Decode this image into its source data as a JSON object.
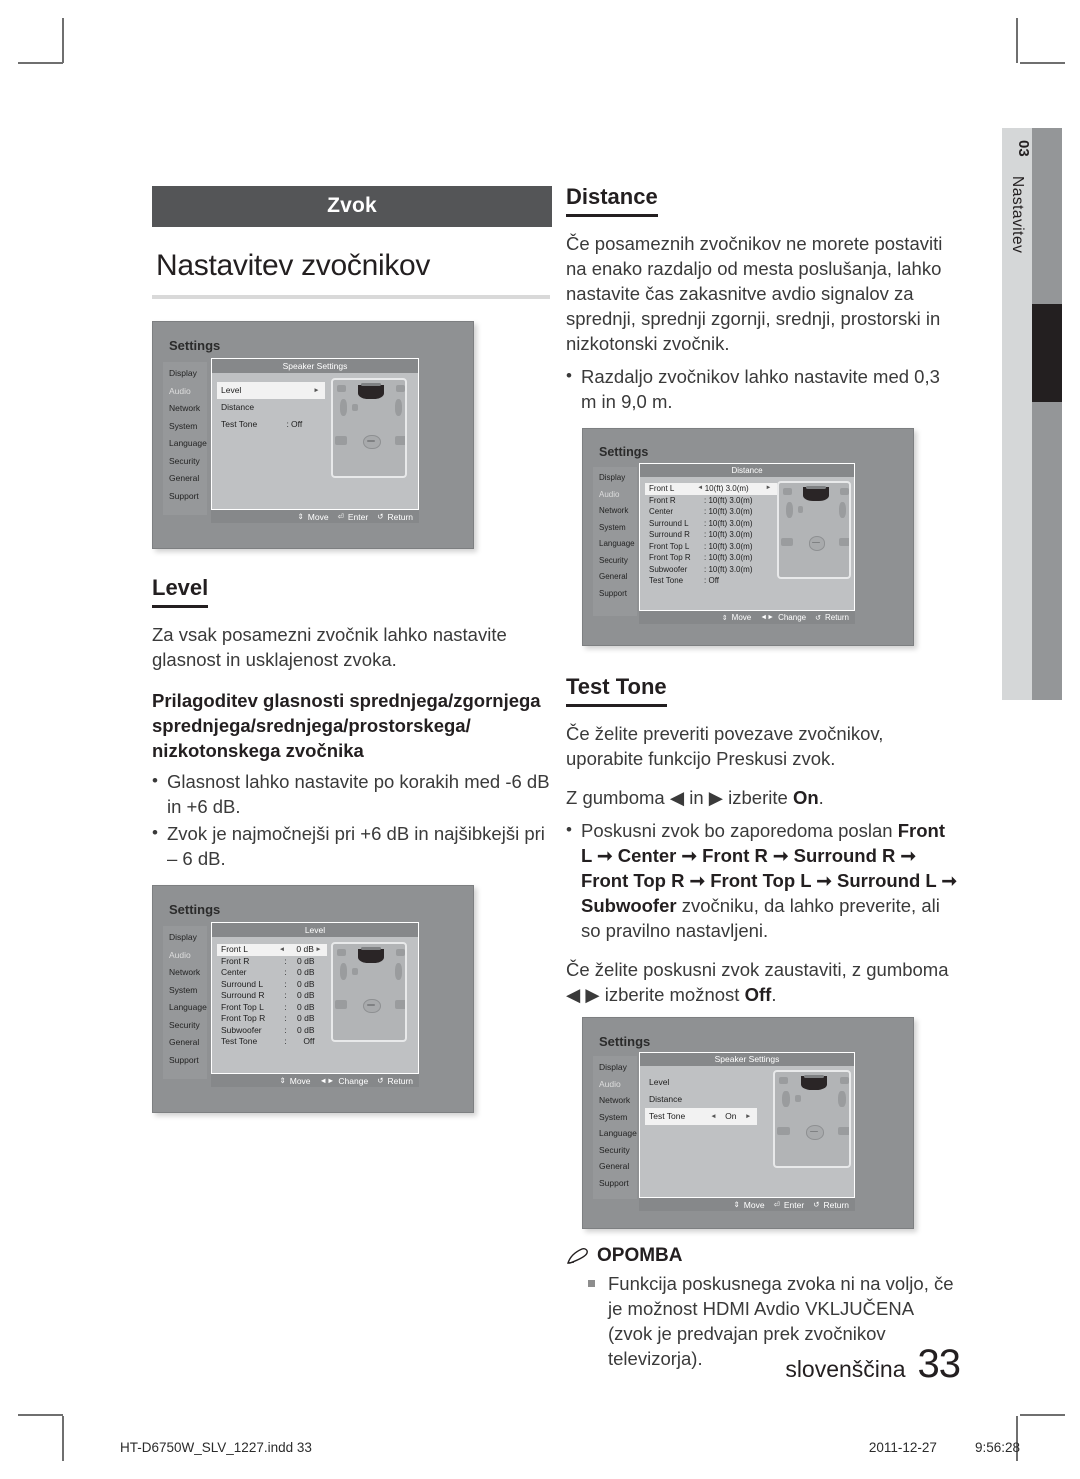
{
  "page": {
    "section_bar_label": "Zvok",
    "title": "Nastavitev zvočnikov",
    "language": "slovenščina",
    "page_number": "33",
    "side_tab": {
      "number": "03",
      "label": "Nastavitev"
    }
  },
  "footer": {
    "file": "HT-D6750W_SLV_1227.indd   33",
    "date": "2011-12-27",
    "time": "9:56:28"
  },
  "left": {
    "level": {
      "heading": "Level",
      "para": "Za vsak posamezni zvočnik lahko nastavite glasnost in usklajenost zvoka.",
      "bold_heading": "Prilagoditev glasnosti sprednjega/zgornjega sprednjega/srednjega/prostorskega/ nizkotonskega zvočnika",
      "bullets": [
        "Glasnost lahko nastavite po korakih med -6 dB in +6 dB.",
        "Zvok je najmočnejši pri +6 dB in najšibkejši pri – 6 dB."
      ]
    }
  },
  "right": {
    "distance": {
      "heading": "Distance",
      "para": "Če posameznih zvočnikov ne morete postaviti na enako razdaljo od mesta poslušanja, lahko nastavite čas zakasnitve avdio signalov za sprednji, sprednji zgornji, srednji, prostorski in nizkotonski zvočnik.",
      "bullets": [
        "Razdaljo zvočnikov lahko nastavite med 0,3 m in 9,0 m."
      ]
    },
    "test_tone": {
      "heading": "Test Tone",
      "para1": "Če želite preveriti povezave zvočnikov, uporabite funkcijo Preskusi zvok.",
      "para2_pre": "Z gumboma ",
      "para2_left_arrow": "◀",
      "para2_mid": " in ",
      "para2_right_arrow": "▶",
      "para2_post": " izberite ",
      "para2_bold": "On",
      "para2_end": ".",
      "bullet_pre": "Poskusni zvok bo zaporedoma poslan ",
      "bullet_chain": "Front L ➞ Center ➞ Front R ➞ Surround R ➞ Front Top R ➞ Front Top L ➞ Surround L ➞ Subwoofer",
      "bullet_post": " zvočniku, da lahko preverite, ali so pravilno nastavljeni.",
      "para3_pre": "Če želite poskusni zvok zaustaviti, z gumboma ",
      "para3_arrows": "◀ ▶",
      "para3_mid": " izberite možnost ",
      "para3_bold": "Off",
      "para3_end": "."
    },
    "note": {
      "heading": "OPOMBA",
      "items": [
        "Funkcija poskusnega zvoka ni na voljo, če je možnost HDMI Avdio VKLJUČENA (zvok je predvajan prek zvočnikov televizorja)."
      ]
    }
  },
  "screens": {
    "speaker_settings_off": {
      "title": "Settings",
      "nav": [
        "Display",
        "Audio",
        "Network",
        "System",
        "Language",
        "Security",
        "General",
        "Support"
      ],
      "active_nav": "Audio",
      "panel_title": "Speaker Settings",
      "rows": [
        {
          "label": "Level",
          "sep": "",
          "value": "",
          "selected": true,
          "left_arrow": false,
          "right_arrow": true
        },
        {
          "label": "Distance",
          "sep": "",
          "value": "",
          "selected": false,
          "left_arrow": false,
          "right_arrow": false
        },
        {
          "label": "Test Tone",
          "sep": ":",
          "value": "Off",
          "selected": false,
          "left_arrow": false,
          "right_arrow": false
        }
      ],
      "footer": [
        "Move",
        "Enter",
        "Return"
      ]
    },
    "level": {
      "title": "Settings",
      "nav": [
        "Display",
        "Audio",
        "Network",
        "System",
        "Language",
        "Security",
        "General",
        "Support"
      ],
      "active_nav": "Audio",
      "panel_title": "Level",
      "rows": [
        {
          "label": "Front L",
          "sep": "",
          "value": "0 dB",
          "selected": true,
          "left_arrow": true,
          "right_arrow": true
        },
        {
          "label": "Front R",
          "sep": ":",
          "value": "0 dB",
          "selected": false,
          "left_arrow": false,
          "right_arrow": false
        },
        {
          "label": "Center",
          "sep": ":",
          "value": "0 dB",
          "selected": false,
          "left_arrow": false,
          "right_arrow": false
        },
        {
          "label": "Surround L",
          "sep": ":",
          "value": "0 dB",
          "selected": false,
          "left_arrow": false,
          "right_arrow": false
        },
        {
          "label": "Surround R",
          "sep": ":",
          "value": "0 dB",
          "selected": false,
          "left_arrow": false,
          "right_arrow": false
        },
        {
          "label": "Front Top L",
          "sep": ":",
          "value": "0 dB",
          "selected": false,
          "left_arrow": false,
          "right_arrow": false
        },
        {
          "label": "Front Top R",
          "sep": ":",
          "value": "0 dB",
          "selected": false,
          "left_arrow": false,
          "right_arrow": false
        },
        {
          "label": "Subwoofer",
          "sep": ":",
          "value": "0 dB",
          "selected": false,
          "left_arrow": false,
          "right_arrow": false
        },
        {
          "label": "Test Tone",
          "sep": ":",
          "value": "Off",
          "selected": false,
          "left_arrow": false,
          "right_arrow": false
        }
      ],
      "footer": [
        "Move",
        "Change",
        "Return"
      ]
    },
    "distance": {
      "title": "Settings",
      "nav": [
        "Display",
        "Audio",
        "Network",
        "System",
        "Language",
        "Security",
        "General",
        "Support"
      ],
      "active_nav": "Audio",
      "panel_title": "Distance",
      "rows": [
        {
          "label": "Front L",
          "sep": "",
          "value": "10(ft) 3.0(m)",
          "selected": true,
          "left_arrow": true,
          "right_arrow": true
        },
        {
          "label": "Front R",
          "sep": ":",
          "value": "10(ft) 3.0(m)",
          "selected": false,
          "left_arrow": false,
          "right_arrow": false
        },
        {
          "label": "Center",
          "sep": ":",
          "value": "10(ft) 3.0(m)",
          "selected": false,
          "left_arrow": false,
          "right_arrow": false
        },
        {
          "label": "Surround L",
          "sep": ":",
          "value": "10(ft) 3.0(m)",
          "selected": false,
          "left_arrow": false,
          "right_arrow": false
        },
        {
          "label": "Surround R",
          "sep": ":",
          "value": "10(ft) 3.0(m)",
          "selected": false,
          "left_arrow": false,
          "right_arrow": false
        },
        {
          "label": "Front Top L",
          "sep": ":",
          "value": "10(ft) 3.0(m)",
          "selected": false,
          "left_arrow": false,
          "right_arrow": false
        },
        {
          "label": "Front Top R",
          "sep": ":",
          "value": "10(ft) 3.0(m)",
          "selected": false,
          "left_arrow": false,
          "right_arrow": false
        },
        {
          "label": "Subwoofer",
          "sep": ":",
          "value": "10(ft) 3.0(m)",
          "selected": false,
          "left_arrow": false,
          "right_arrow": false
        },
        {
          "label": "Test Tone",
          "sep": ":",
          "value": "Off",
          "selected": false,
          "left_arrow": false,
          "right_arrow": false
        }
      ],
      "footer": [
        "Move",
        "Change",
        "Return"
      ]
    },
    "speaker_settings_on": {
      "title": "Settings",
      "nav": [
        "Display",
        "Audio",
        "Network",
        "System",
        "Language",
        "Security",
        "General",
        "Support"
      ],
      "active_nav": "Audio",
      "panel_title": "Speaker Settings",
      "rows": [
        {
          "label": "Level",
          "sep": "",
          "value": "",
          "selected": false,
          "left_arrow": false,
          "right_arrow": false
        },
        {
          "label": "Distance",
          "sep": "",
          "value": "",
          "selected": false,
          "left_arrow": false,
          "right_arrow": false
        },
        {
          "label": "Test Tone",
          "sep": "",
          "value": "On",
          "selected": true,
          "left_arrow": true,
          "right_arrow": true
        }
      ],
      "footer": [
        "Move",
        "Enter",
        "Return"
      ]
    }
  },
  "colors": {
    "section_bar": "#545557",
    "text": "#231f20",
    "body_text": "#3a3a3a",
    "sidetab_bg": "#d5d7d8",
    "sidebar_strip": "#949698",
    "sidebar_active": "#231f20"
  }
}
